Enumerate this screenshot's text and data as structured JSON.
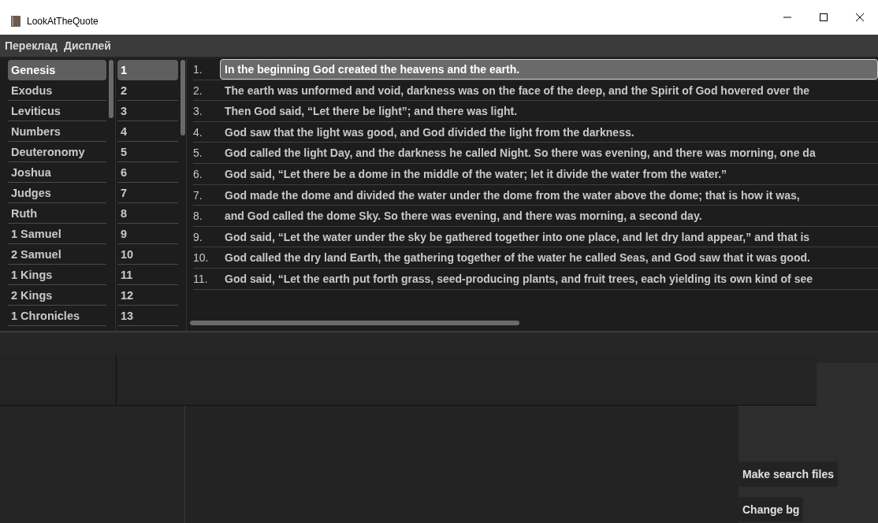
{
  "window": {
    "title": "LookAtTheQuote"
  },
  "menu": [
    "Переклад",
    "Дисплей"
  ],
  "books": [
    {
      "label": "Genesis",
      "selected": true
    },
    {
      "label": "Exodus",
      "selected": false
    },
    {
      "label": "Leviticus",
      "selected": false
    },
    {
      "label": "Numbers",
      "selected": false
    },
    {
      "label": "Deuteronomy",
      "selected": false
    },
    {
      "label": "Joshua",
      "selected": false
    },
    {
      "label": "Judges",
      "selected": false
    },
    {
      "label": "Ruth",
      "selected": false
    },
    {
      "label": "1 Samuel",
      "selected": false
    },
    {
      "label": "2 Samuel",
      "selected": false
    },
    {
      "label": "1 Kings",
      "selected": false
    },
    {
      "label": "2 Kings",
      "selected": false
    },
    {
      "label": "1 Chronicles",
      "selected": false
    }
  ],
  "chapters": [
    {
      "label": "1",
      "selected": true
    },
    {
      "label": "2",
      "selected": false
    },
    {
      "label": "3",
      "selected": false
    },
    {
      "label": "4",
      "selected": false
    },
    {
      "label": "5",
      "selected": false
    },
    {
      "label": "6",
      "selected": false
    },
    {
      "label": "7",
      "selected": false
    },
    {
      "label": "8",
      "selected": false
    },
    {
      "label": "9",
      "selected": false
    },
    {
      "label": "10",
      "selected": false
    },
    {
      "label": "11",
      "selected": false
    },
    {
      "label": "12",
      "selected": false
    },
    {
      "label": "13",
      "selected": false
    }
  ],
  "verses": [
    {
      "number": "1.",
      "text": "In the beginning God created the heavens and the earth.",
      "selected": true
    },
    {
      "number": "2.",
      "text": "The earth was unformed and void, darkness was on the face of the deep, and the Spirit of God hovered over the",
      "selected": false
    },
    {
      "number": "3.",
      "text": "Then God said, “Let there be light”; and there was light.",
      "selected": false
    },
    {
      "number": "4.",
      "text": "God saw that the light was good, and God divided the light from the darkness.",
      "selected": false
    },
    {
      "number": "5.",
      "text": "God called the light Day, and the darkness he called Night. So there was evening, and there was morning, one da",
      "selected": false
    },
    {
      "number": "6.",
      "text": "God said, “Let there be a dome in the middle of the water; let it divide the water from the water.”",
      "selected": false
    },
    {
      "number": "7.",
      "text": "God made the dome and divided the water under the dome from the water above the dome; that is how it was,",
      "selected": false
    },
    {
      "number": "8.",
      "text": "and God called the dome Sky. So there was evening, and there was morning, a second day.",
      "selected": false
    },
    {
      "number": "9.",
      "text": "God said, “Let the water under the sky be gathered together into one place, and let dry land appear,” and that is",
      "selected": false
    },
    {
      "number": "10.",
      "text": "God called the dry land Earth, the gathering together of the water he called Seas, and God saw that it was good.",
      "selected": false
    },
    {
      "number": "11.",
      "text": "God said, “Let the earth put forth grass, seed-producing plants, and fruit trees, each yielding its own kind of see",
      "selected": false
    }
  ],
  "buttons": [
    "Make search files",
    "Change bg"
  ]
}
